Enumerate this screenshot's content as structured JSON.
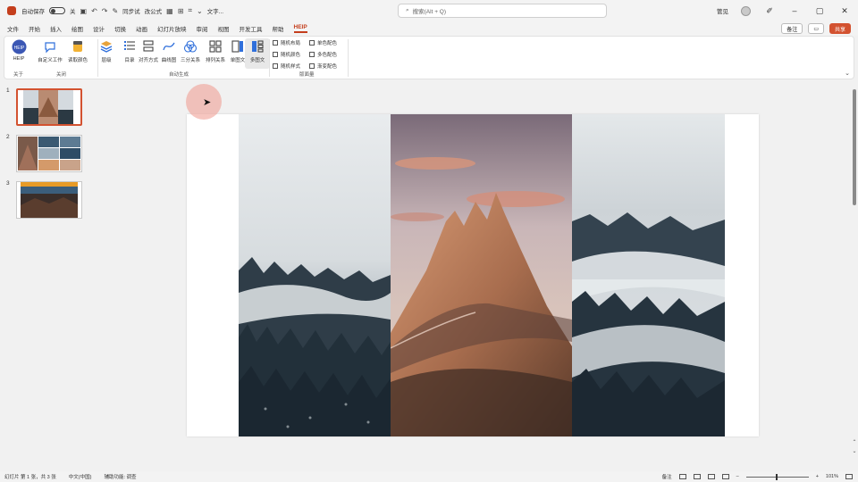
{
  "colors": {
    "accent": "#c43e1c",
    "share": "#d35230",
    "selection": "#d35230"
  },
  "titlebar": {
    "autosave_label": "自动保存",
    "autosave_state": "关",
    "qa_labels": [
      "同步试",
      "改公式",
      "文字..."
    ],
    "search_placeholder": "搜索(Alt + Q)",
    "user": "管见",
    "icons": [
      "save-icon",
      "undo-icon",
      "redo-icon",
      "format-painter-icon",
      "pen-icon",
      "grid-icon",
      "table-icon",
      "crop-icon",
      "chevron-down-icon"
    ]
  },
  "menu": {
    "tabs": [
      "文件",
      "开始",
      "插入",
      "绘图",
      "设计",
      "切换",
      "动画",
      "幻灯片放映",
      "审阅",
      "视图",
      "开发工具",
      "帮助",
      "HEIP"
    ],
    "active": "HEIP",
    "comment_label": "备注",
    "share_label": "共享"
  },
  "ribbon": {
    "buttons": [
      {
        "label": "HEIP",
        "icon": "heip-logo-icon"
      },
      {
        "label": "自定义工作",
        "icon": "chat-bubble-icon"
      },
      {
        "label": "读取颜色",
        "icon": "paint-bucket-icon"
      },
      {
        "label": "层级",
        "icon": "layers-icon"
      },
      {
        "label": "目录",
        "icon": "list-icon"
      },
      {
        "label": "对齐方式",
        "icon": "align-icon"
      },
      {
        "label": "曲线图",
        "icon": "curve-icon"
      },
      {
        "label": "三分关系",
        "icon": "venn-icon"
      },
      {
        "label": "排列关系",
        "icon": "grid-layout-icon"
      },
      {
        "label": "单图文",
        "icon": "single-image-icon"
      },
      {
        "label": "多图文",
        "icon": "multi-image-icon"
      }
    ],
    "groups": [
      "关于",
      "关闭",
      "自动生成",
      "版面量"
    ],
    "checks": [
      "随机布局",
      "单色配色",
      "随机颜色",
      "多色配色",
      "随机样式",
      "渐变配色"
    ]
  },
  "thumbnails": [
    {
      "number": "1"
    },
    {
      "number": "2"
    },
    {
      "number": "3"
    }
  ],
  "statusbar": {
    "slide_info": "幻灯片 第 1 张，共 3 张",
    "language": "中文(中国)",
    "accessibility": "辅助功能: 调查",
    "notes_label": "备注",
    "zoom": "101%"
  }
}
